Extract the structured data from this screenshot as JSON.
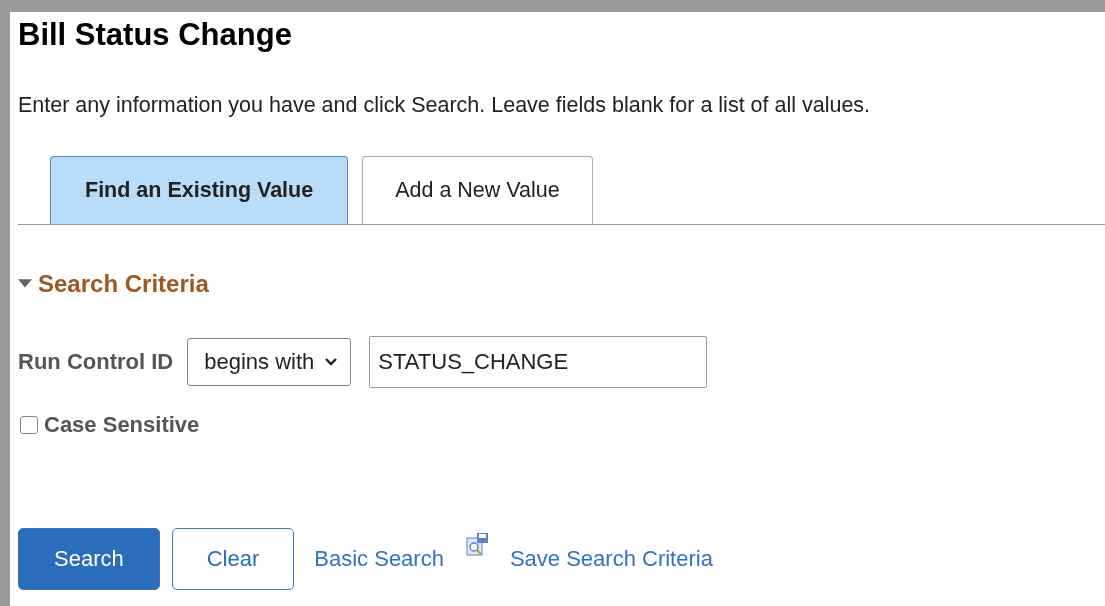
{
  "page": {
    "title": "Bill Status Change",
    "instructions": "Enter any information you have and click Search. Leave fields blank for a list of all values."
  },
  "tabs": [
    {
      "label": "Find an Existing Value",
      "selected": true
    },
    {
      "label": "Add a New Value",
      "selected": false
    }
  ],
  "search_criteria": {
    "title": "Search Criteria",
    "expanded": true,
    "run_control_id": {
      "label": "Run Control ID",
      "operator": "begins with",
      "value": "STATUS_CHANGE"
    },
    "case_sensitive": {
      "label": "Case Sensitive",
      "checked": false
    }
  },
  "actions": {
    "search": "Search",
    "clear": "Clear",
    "basic_search": "Basic Search",
    "save_search_criteria": "Save Search Criteria"
  }
}
